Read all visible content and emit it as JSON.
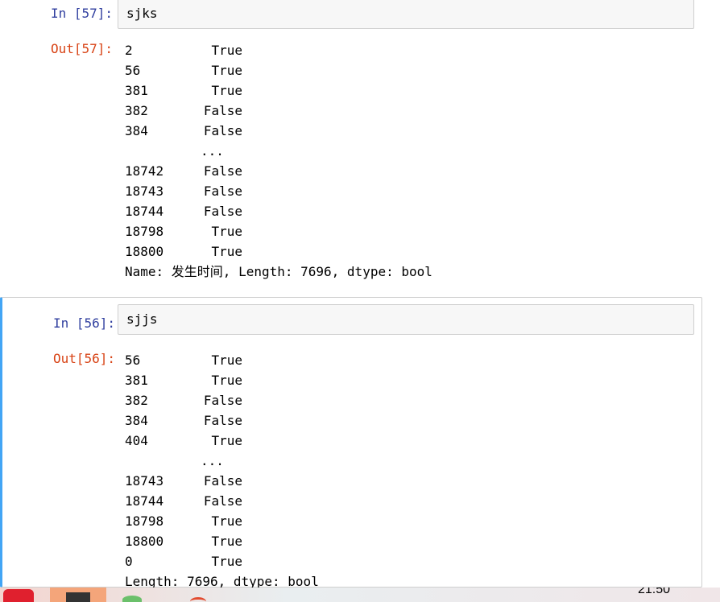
{
  "cells": [
    {
      "in_prompt": "In  [57]:",
      "code": "sjks",
      "out_prompt": "Out[57]:",
      "rows": [
        {
          "index": "2",
          "value": "True"
        },
        {
          "index": "56",
          "value": "True"
        },
        {
          "index": "381",
          "value": "True"
        },
        {
          "index": "382",
          "value": "False"
        },
        {
          "index": "384",
          "value": "False"
        },
        {
          "index": "",
          "value": "..."
        },
        {
          "index": "18742",
          "value": "False"
        },
        {
          "index": "18743",
          "value": "False"
        },
        {
          "index": "18744",
          "value": "False"
        },
        {
          "index": "18798",
          "value": "True"
        },
        {
          "index": "18800",
          "value": "True"
        }
      ],
      "footer": "Name: 发生时间, Length: 7696, dtype: bool"
    },
    {
      "in_prompt": "In  [56]:",
      "code": "sjjs",
      "out_prompt": "Out[56]:",
      "rows": [
        {
          "index": "56",
          "value": "True"
        },
        {
          "index": "381",
          "value": "True"
        },
        {
          "index": "382",
          "value": "False"
        },
        {
          "index": "384",
          "value": "False"
        },
        {
          "index": "404",
          "value": "True"
        },
        {
          "index": "",
          "value": "..."
        },
        {
          "index": "18743",
          "value": "False"
        },
        {
          "index": "18744",
          "value": "False"
        },
        {
          "index": "18798",
          "value": "True"
        },
        {
          "index": "18800",
          "value": "True"
        },
        {
          "index": "0",
          "value": "True"
        }
      ],
      "footer": "Length: 7696, dtype: bool"
    }
  ],
  "taskbar": {
    "clock": "21:50"
  },
  "colors": {
    "in_prompt": "#303f9f",
    "out_prompt": "#d84315",
    "selected_border": "#42a5f5"
  }
}
